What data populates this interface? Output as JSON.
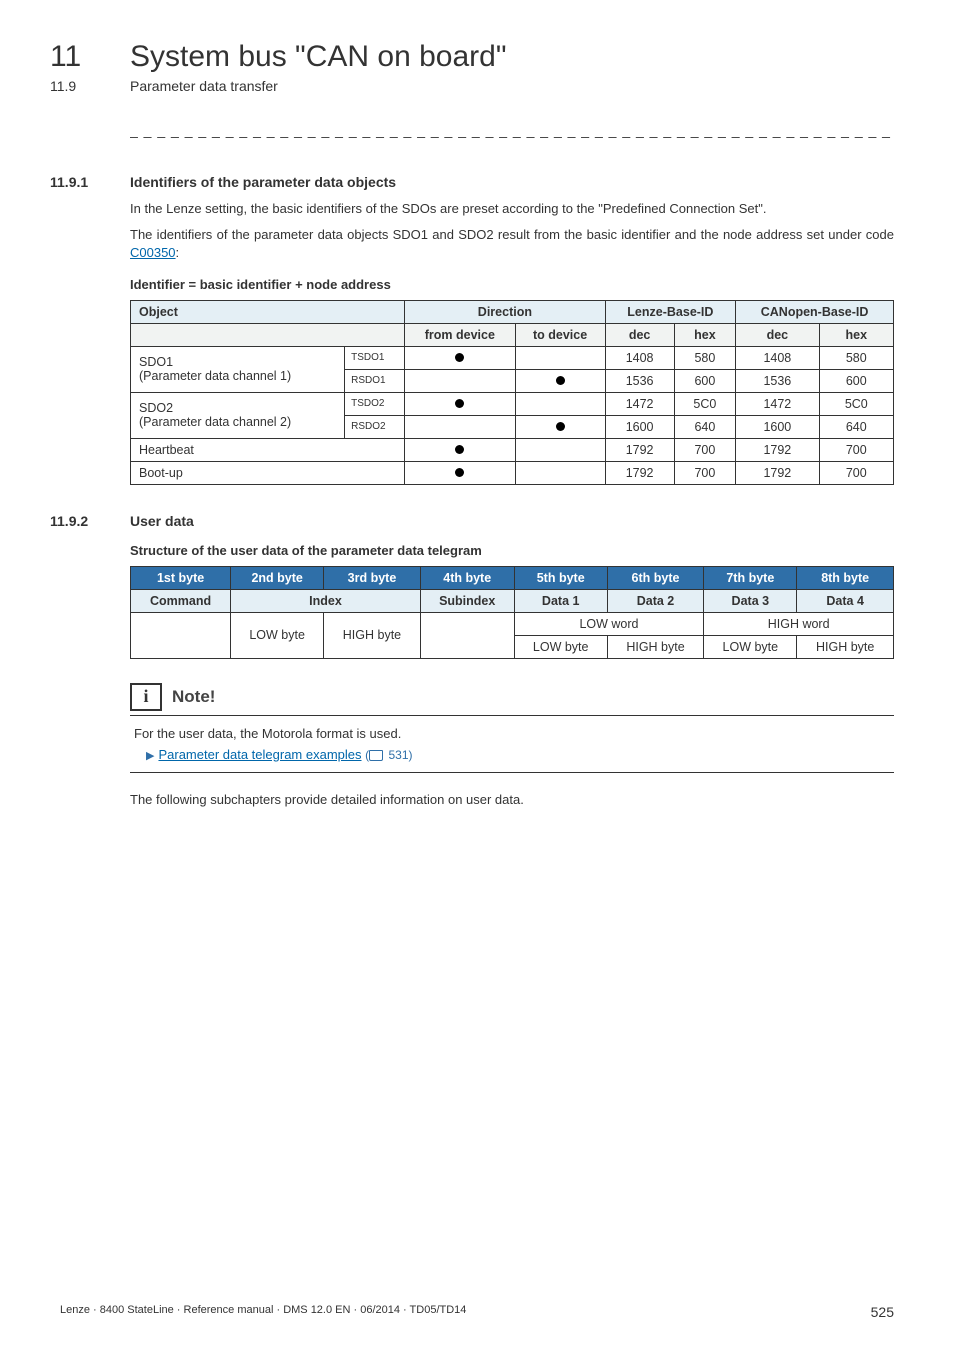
{
  "chapter": {
    "number": "11",
    "title": "System bus \"CAN on board\""
  },
  "subheader": {
    "number": "11.9",
    "title": "Parameter data transfer"
  },
  "dashes": "_ _ _ _ _ _ _ _ _ _ _ _ _ _ _ _ _ _ _ _ _ _ _ _ _ _ _ _ _ _ _ _ _ _ _ _ _ _ _ _ _ _ _ _ _ _ _ _ _ _ _ _ _ _ _ _ _ _ _ _ _ _ _ _",
  "s1": {
    "num": "11.9.1",
    "title": "Identifiers of the parameter data objects",
    "p1": "In the Lenze setting, the basic identifiers of the SDOs are preset according to the \"Predefined Connection Set\".",
    "p2_a": "The identifiers of the parameter data objects SDO1 and SDO2 result from the basic identifier and the node address set under code ",
    "p2_link": "C00350",
    "p2_b": ":",
    "formula": "Identifier = basic identifier + node address"
  },
  "t1": {
    "h_object": "Object",
    "h_direction": "Direction",
    "h_lenze": "Lenze-Base-ID",
    "h_canopen": "CANopen-Base-ID",
    "sh_from": "from device",
    "sh_to": "to device",
    "sh_dec": "dec",
    "sh_hex": "hex",
    "r1": {
      "obj_a": "SDO1",
      "obj_b": "(Parameter data channel 1)",
      "sub": "TSDO1",
      "ldec": "1408",
      "lhex": "580",
      "cdec": "1408",
      "chex": "580"
    },
    "r2": {
      "sub": "RSDO1",
      "ldec": "1536",
      "lhex": "600",
      "cdec": "1536",
      "chex": "600"
    },
    "r3": {
      "obj_a": "SDO2",
      "obj_b": "(Parameter data channel 2)",
      "sub": "TSDO2",
      "ldec": "1472",
      "lhex": "5C0",
      "cdec": "1472",
      "chex": "5C0"
    },
    "r4": {
      "sub": "RSDO2",
      "ldec": "1600",
      "lhex": "640",
      "cdec": "1600",
      "chex": "640"
    },
    "r5": {
      "obj": "Heartbeat",
      "ldec": "1792",
      "lhex": "700",
      "cdec": "1792",
      "chex": "700"
    },
    "r6": {
      "obj": "Boot-up",
      "ldec": "1792",
      "lhex": "700",
      "cdec": "1792",
      "chex": "700"
    }
  },
  "s2": {
    "num": "11.9.2",
    "title": "User data",
    "subtitle": "Structure of the user data of the parameter data telegram"
  },
  "t2": {
    "b1": "1st byte",
    "b2": "2nd byte",
    "b3": "3rd byte",
    "b4": "4th byte",
    "b5": "5th byte",
    "b6": "6th byte",
    "b7": "7th byte",
    "b8": "8th byte",
    "command": "Command",
    "index": "Index",
    "subindex": "Subindex",
    "d1": "Data 1",
    "d2": "Data 2",
    "d3": "Data 3",
    "d4": "Data 4",
    "lowbyte": "LOW byte",
    "highbyte": "HIGH byte",
    "lowword": "LOW word",
    "highword": "HIGH word"
  },
  "note": {
    "title": "Note!",
    "body": "For the user data, the Motorola format is used.",
    "link_text": "Parameter data telegram examples",
    "link_page": "531"
  },
  "closing": "The following subchapters provide detailed information on user data.",
  "footer": {
    "left": "Lenze · 8400 StateLine · Reference manual · DMS 12.0 EN · 06/2014 · TD05/TD14",
    "right": "525"
  }
}
